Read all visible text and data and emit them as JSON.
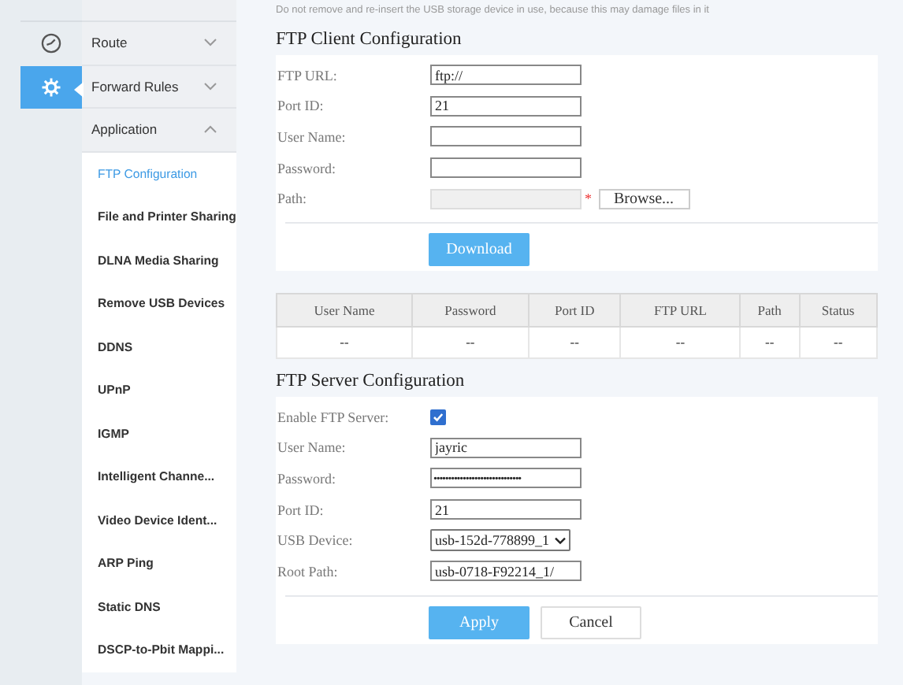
{
  "rail": [
    {
      "kind": "dashboard",
      "selected": false
    },
    {
      "kind": "settings",
      "selected": true
    }
  ],
  "sidebar": {
    "items": [
      {
        "label": "Route",
        "expanded": false,
        "selected": false
      },
      {
        "label": "Forward Rules",
        "expanded": false,
        "selected": false
      },
      {
        "label": "Application",
        "expanded": true,
        "selected": false,
        "children": [
          {
            "label": "FTP Configuration",
            "selected": true
          },
          {
            "label": "File and Printer Sharing",
            "selected": false
          },
          {
            "label": "DLNA Media Sharing",
            "selected": false
          },
          {
            "label": "Remove USB Devices",
            "selected": false
          },
          {
            "label": "DDNS",
            "selected": false
          },
          {
            "label": "UPnP",
            "selected": false
          },
          {
            "label": "IGMP",
            "selected": false
          },
          {
            "label": "Intelligent Channe...",
            "selected": false
          },
          {
            "label": "Video Device Ident...",
            "selected": false
          },
          {
            "label": "ARP Ping",
            "selected": false
          },
          {
            "label": "Static DNS",
            "selected": false
          },
          {
            "label": "DSCP-to-Pbit Mappi...",
            "selected": false
          }
        ]
      }
    ]
  },
  "notice": "Do not remove and re-insert the USB storage device in use, because this may damage files in it",
  "client": {
    "title": "FTP Client Configuration",
    "fields": [
      {
        "kind": "text",
        "label": "FTP URL:",
        "value": "ftp://"
      },
      {
        "kind": "text",
        "label": "Port ID:",
        "value": "21"
      },
      {
        "kind": "text",
        "label": "User Name:"
      },
      {
        "kind": "text",
        "label": "Password:"
      },
      {
        "kind": "file",
        "label": "Path:",
        "required": "*",
        "button": "Browse...",
        "disabled": true
      }
    ],
    "button": "Download"
  },
  "table": {
    "columns": [
      "User Name",
      "Password",
      "Port ID",
      "FTP URL",
      "Path",
      "Status"
    ],
    "rows": [
      [
        "--",
        "--",
        "--",
        "--",
        "--",
        "--"
      ]
    ]
  },
  "server": {
    "title": "FTP Server Configuration",
    "fields": [
      {
        "kind": "checkbox",
        "label": "Enable FTP Server:",
        "checked": true
      },
      {
        "kind": "text",
        "label": "User Name:",
        "value": "jayric"
      },
      {
        "kind": "password",
        "label": "Password:",
        "value": "••••••••••••••••••••••••••••••"
      },
      {
        "kind": "text",
        "label": "Port ID:",
        "value": "21"
      },
      {
        "kind": "select",
        "label": "USB Device:",
        "value": "usb-152d-778899_1"
      },
      {
        "kind": "text",
        "label": "Root Path:",
        "value": "usb-0718-F92214_1/"
      }
    ],
    "buttons": [
      {
        "label": "Apply",
        "primary": true
      },
      {
        "label": "Cancel",
        "primary": false
      }
    ]
  }
}
